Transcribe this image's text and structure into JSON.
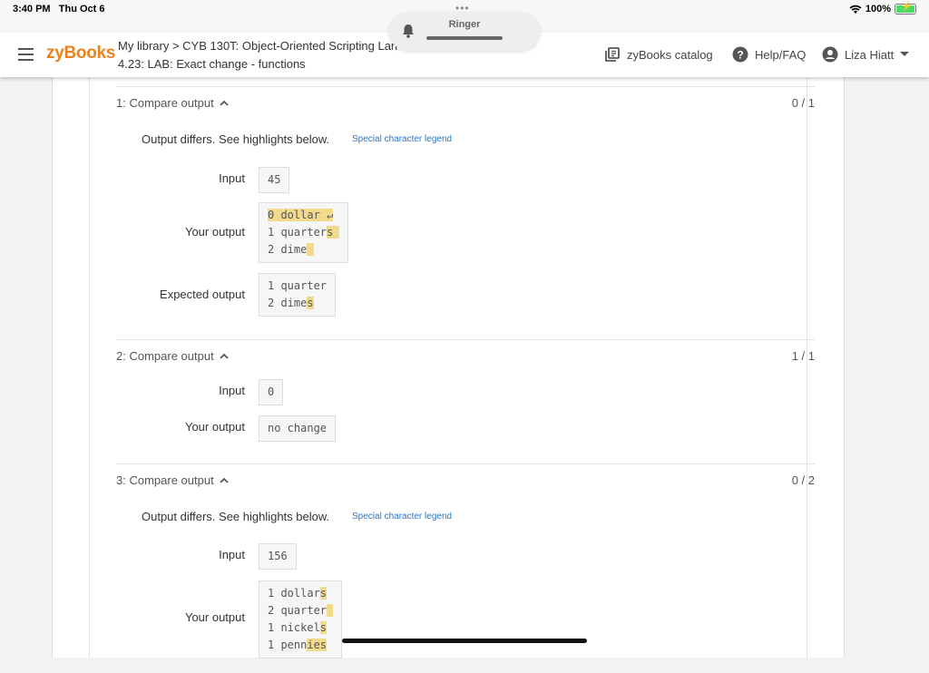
{
  "status_bar": {
    "time": "3:40 PM",
    "date": "Thu Oct 6",
    "battery": "100%",
    "battery_level": 1.0
  },
  "ringer": {
    "label": "Ringer"
  },
  "header": {
    "logo": "zyBooks",
    "breadcrumb_line1": "My library > CYB 130T: Object-Oriented Scripting Lan",
    "breadcrumb_line2": "4.23: LAB: Exact change - functions",
    "catalog": "zyBooks catalog",
    "help": "Help/FAQ",
    "user": "Liza Hiatt"
  },
  "tests": [
    {
      "title": "1: Compare output",
      "score": "0 / 1",
      "diff_message": "Output differs. See highlights below.",
      "legend_link": "Special character legend",
      "input_label": "Input",
      "input": "45",
      "your_output_label": "Your output",
      "your_output": [
        {
          "text": "",
          "hl": "0 dollar ↵"
        },
        {
          "text": "1 quarter",
          "hl": "s "
        },
        {
          "text": "2 dime",
          "hl": " "
        }
      ],
      "expected_output_label": "Expected output",
      "expected_output": [
        {
          "text": "1 quarter",
          "hl": ""
        },
        {
          "text": "2 dime",
          "hl": "s"
        }
      ]
    },
    {
      "title": "2: Compare output",
      "score": "1 / 1",
      "input_label": "Input",
      "input": "0",
      "your_output_label": "Your output",
      "your_output": "no change"
    },
    {
      "title": "3: Compare output",
      "score": "0 / 2",
      "diff_message": "Output differs. See highlights below.",
      "legend_link": "Special character legend",
      "input_label": "Input",
      "input": "156",
      "your_output_label": "Your output",
      "your_output": [
        {
          "text": "1 dollar",
          "hl": "s"
        },
        {
          "text": "2 quarter",
          "hl": " "
        },
        {
          "text": "1 nickel",
          "hl": "s"
        },
        {
          "text": "1 penn",
          "hl": "ies"
        }
      ]
    }
  ]
}
